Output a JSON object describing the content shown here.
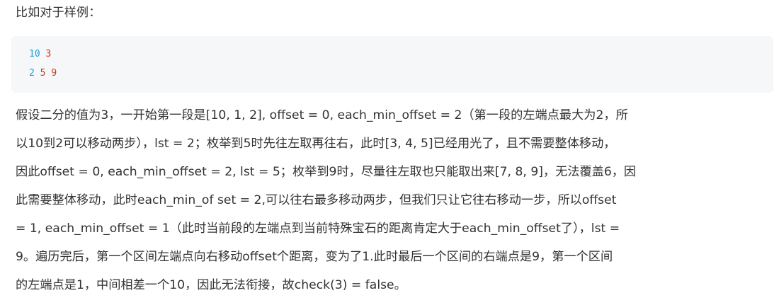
{
  "intro": "比如对于样例：",
  "code": {
    "lines": [
      [
        "10",
        "3"
      ],
      [
        "2",
        "5",
        "9"
      ]
    ]
  },
  "paragraph": {
    "lines": [
      "假设二分的值为3，一开始第一段是[10, 1, 2], offset = 0, each_min_offset = 2（第一段的左端点最大为2，所",
      "以10到2可以移动两步），lst = 2；枚举到5时先往左取再往右，此时[3, 4, 5]已经用光了，且不需要整体移动，",
      "因此offset = 0, each_min_offset = 2, lst = 5；枚举到9时，尽量往左取也只能取出来[7, 8, 9]，无法覆盖6，因",
      "此需要整体移动，此时each_min_of set = 2,可以往右最多移动两步，但我们只让它往右移动一步，所以offset",
      "= 1, each_min_offset = 1（此时当前段的左端点到当前特殊宝石的距离肯定大于each_min_offset了），lst =",
      "9。遍历完后，第一个区间左端点向右移动offset个距离，变为了1.此时最后一个区间的右端点是9，第一个区间",
      "的左端点是1，中间相差一个10，因此无法衔接，故check(3) = false。"
    ]
  },
  "colors": {
    "code_number_first": "#1a9fd6",
    "code_number_rest": "#c0392b",
    "code_background": "#f6f7f9",
    "text": "#333333"
  }
}
